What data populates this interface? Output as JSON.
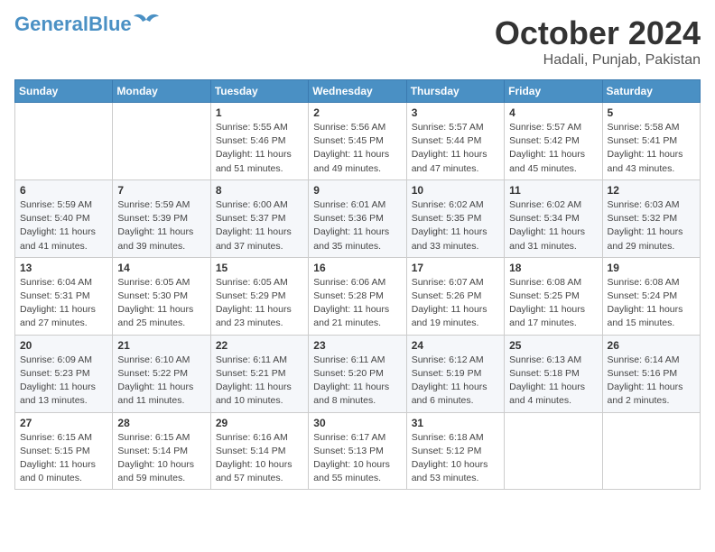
{
  "logo": {
    "general": "General",
    "blue": "Blue"
  },
  "header": {
    "month": "October 2024",
    "location": "Hadali, Punjab, Pakistan"
  },
  "weekdays": [
    "Sunday",
    "Monday",
    "Tuesday",
    "Wednesday",
    "Thursday",
    "Friday",
    "Saturday"
  ],
  "weeks": [
    [
      {
        "day": "",
        "info": ""
      },
      {
        "day": "",
        "info": ""
      },
      {
        "day": "1",
        "info": "Sunrise: 5:55 AM\nSunset: 5:46 PM\nDaylight: 11 hours and 51 minutes."
      },
      {
        "day": "2",
        "info": "Sunrise: 5:56 AM\nSunset: 5:45 PM\nDaylight: 11 hours and 49 minutes."
      },
      {
        "day": "3",
        "info": "Sunrise: 5:57 AM\nSunset: 5:44 PM\nDaylight: 11 hours and 47 minutes."
      },
      {
        "day": "4",
        "info": "Sunrise: 5:57 AM\nSunset: 5:42 PM\nDaylight: 11 hours and 45 minutes."
      },
      {
        "day": "5",
        "info": "Sunrise: 5:58 AM\nSunset: 5:41 PM\nDaylight: 11 hours and 43 minutes."
      }
    ],
    [
      {
        "day": "6",
        "info": "Sunrise: 5:59 AM\nSunset: 5:40 PM\nDaylight: 11 hours and 41 minutes."
      },
      {
        "day": "7",
        "info": "Sunrise: 5:59 AM\nSunset: 5:39 PM\nDaylight: 11 hours and 39 minutes."
      },
      {
        "day": "8",
        "info": "Sunrise: 6:00 AM\nSunset: 5:37 PM\nDaylight: 11 hours and 37 minutes."
      },
      {
        "day": "9",
        "info": "Sunrise: 6:01 AM\nSunset: 5:36 PM\nDaylight: 11 hours and 35 minutes."
      },
      {
        "day": "10",
        "info": "Sunrise: 6:02 AM\nSunset: 5:35 PM\nDaylight: 11 hours and 33 minutes."
      },
      {
        "day": "11",
        "info": "Sunrise: 6:02 AM\nSunset: 5:34 PM\nDaylight: 11 hours and 31 minutes."
      },
      {
        "day": "12",
        "info": "Sunrise: 6:03 AM\nSunset: 5:32 PM\nDaylight: 11 hours and 29 minutes."
      }
    ],
    [
      {
        "day": "13",
        "info": "Sunrise: 6:04 AM\nSunset: 5:31 PM\nDaylight: 11 hours and 27 minutes."
      },
      {
        "day": "14",
        "info": "Sunrise: 6:05 AM\nSunset: 5:30 PM\nDaylight: 11 hours and 25 minutes."
      },
      {
        "day": "15",
        "info": "Sunrise: 6:05 AM\nSunset: 5:29 PM\nDaylight: 11 hours and 23 minutes."
      },
      {
        "day": "16",
        "info": "Sunrise: 6:06 AM\nSunset: 5:28 PM\nDaylight: 11 hours and 21 minutes."
      },
      {
        "day": "17",
        "info": "Sunrise: 6:07 AM\nSunset: 5:26 PM\nDaylight: 11 hours and 19 minutes."
      },
      {
        "day": "18",
        "info": "Sunrise: 6:08 AM\nSunset: 5:25 PM\nDaylight: 11 hours and 17 minutes."
      },
      {
        "day": "19",
        "info": "Sunrise: 6:08 AM\nSunset: 5:24 PM\nDaylight: 11 hours and 15 minutes."
      }
    ],
    [
      {
        "day": "20",
        "info": "Sunrise: 6:09 AM\nSunset: 5:23 PM\nDaylight: 11 hours and 13 minutes."
      },
      {
        "day": "21",
        "info": "Sunrise: 6:10 AM\nSunset: 5:22 PM\nDaylight: 11 hours and 11 minutes."
      },
      {
        "day": "22",
        "info": "Sunrise: 6:11 AM\nSunset: 5:21 PM\nDaylight: 11 hours and 10 minutes."
      },
      {
        "day": "23",
        "info": "Sunrise: 6:11 AM\nSunset: 5:20 PM\nDaylight: 11 hours and 8 minutes."
      },
      {
        "day": "24",
        "info": "Sunrise: 6:12 AM\nSunset: 5:19 PM\nDaylight: 11 hours and 6 minutes."
      },
      {
        "day": "25",
        "info": "Sunrise: 6:13 AM\nSunset: 5:18 PM\nDaylight: 11 hours and 4 minutes."
      },
      {
        "day": "26",
        "info": "Sunrise: 6:14 AM\nSunset: 5:16 PM\nDaylight: 11 hours and 2 minutes."
      }
    ],
    [
      {
        "day": "27",
        "info": "Sunrise: 6:15 AM\nSunset: 5:15 PM\nDaylight: 11 hours and 0 minutes."
      },
      {
        "day": "28",
        "info": "Sunrise: 6:15 AM\nSunset: 5:14 PM\nDaylight: 10 hours and 59 minutes."
      },
      {
        "day": "29",
        "info": "Sunrise: 6:16 AM\nSunset: 5:14 PM\nDaylight: 10 hours and 57 minutes."
      },
      {
        "day": "30",
        "info": "Sunrise: 6:17 AM\nSunset: 5:13 PM\nDaylight: 10 hours and 55 minutes."
      },
      {
        "day": "31",
        "info": "Sunrise: 6:18 AM\nSunset: 5:12 PM\nDaylight: 10 hours and 53 minutes."
      },
      {
        "day": "",
        "info": ""
      },
      {
        "day": "",
        "info": ""
      }
    ]
  ]
}
